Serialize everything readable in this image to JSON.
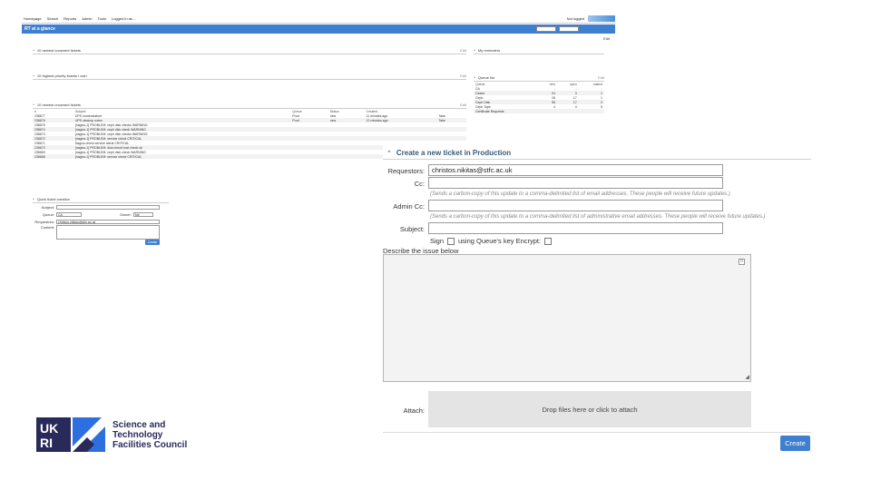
{
  "background": {
    "nav": [
      "Homepage",
      "Search",
      "Reports",
      "Admin",
      "Tools",
      "Logged in as ..."
    ],
    "nav_right": "Not logged",
    "rt_title": "RT at a glance",
    "edit": "Edit",
    "panels": {
      "most_recent": "10 newest unowned tickets",
      "highest_priority": "10 highest priority tickets I own",
      "unowned": "10 newest unowned tickets",
      "my_reminders": "My reminders",
      "quick_ticket": "Quick ticket creation",
      "queue_list": "Queue list",
      "edit_label": "Edit"
    },
    "unowned_headers": [
      "#",
      "Subject",
      "Queue",
      "Status",
      "Created",
      ""
    ],
    "unowned_rows": [
      [
        "238677",
        "UPS nomenclature",
        "Prod",
        "new",
        "11 minutes ago",
        "Take"
      ],
      [
        "238676",
        "UPS cleanup notes",
        "Prod",
        "new",
        "12 minutes ago",
        "Take"
      ],
      [
        "238675",
        "[nagios-1] PROBLEM: ceph disk checks WARNING",
        "",
        "",
        "",
        ""
      ],
      [
        "238674",
        "[nagios-1] PROBLEM: ceph disk check WARNING",
        "",
        "",
        "",
        ""
      ],
      [
        "238673",
        "[nagios-1] PROBLEM: ceph disk checks WARNING",
        "",
        "",
        "",
        ""
      ],
      [
        "238672",
        "[nagios-1] PROBLEM: service check CRITICAL",
        "",
        "",
        "",
        ""
      ],
      [
        "238671",
        "Nagios check service alerts CRITICAL",
        "",
        "",
        "",
        ""
      ],
      [
        "238670",
        "[nagios-1] PROBLEM: disk check host check ok",
        "",
        "",
        "",
        ""
      ],
      [
        "238669",
        "[nagios-1] PROBLEM: ceph disk check WARNING",
        "",
        "",
        "",
        ""
      ],
      [
        "238668",
        "[nagios-1] PROBLEM: service check CRITICAL",
        "",
        "",
        "",
        ""
      ]
    ],
    "queue_headers": [
      "Queue",
      "new",
      "open",
      "stalled"
    ],
    "queue_rows": [
      [
        "CA",
        "-",
        "-",
        "-"
      ],
      [
        "Castor",
        "31",
        "3",
        "1"
      ],
      [
        "Ceph",
        "26",
        "17",
        "1"
      ],
      [
        "Ceph Disk",
        "55",
        "17",
        "2"
      ],
      [
        "Ceph Tape",
        "4",
        "4",
        "5"
      ],
      [
        "Certificate Requests",
        "",
        "",
        ""
      ]
    ],
    "quick_form": {
      "subject_label": "Subject:",
      "queue_label": "Queue:",
      "queue_value": "CA",
      "owner_label": "Owner:",
      "owner_value": "Me",
      "requestors_label": "Requestors:",
      "requestors_value": "christos.nikitas@stfc.ac.uk",
      "content_label": "Content:",
      "create_label": "Create"
    }
  },
  "form": {
    "title": "Create a new ticket in Production",
    "requestors_label": "Requestors:",
    "requestors_value": "christos.nikitas@stfc.ac.uk",
    "cc_label": "Cc:",
    "cc_hint": "(Sends a carbon-copy of this update to a comma-delimited list of email addresses. These people will receive future updates.)",
    "admin_cc_label": "Admin Cc:",
    "admin_cc_hint": "(Sends a carbon-copy of this update to a comma-delimited list of administrative email addresses. These people will receive future updates.)",
    "subject_label": "Subject:",
    "sign_label": "Sign",
    "encrypt_label": "using Queue's key Encrypt:",
    "describe_label": "Describe the issue below",
    "attach_label": "Attach:",
    "dropzone_text": "Drop files here or click to attach",
    "create_label": "Create"
  },
  "logo": {
    "mark": "UKRI",
    "line1": "Science and",
    "line2": "Technology",
    "line3": "Facilities Council"
  },
  "colors": {
    "accent": "#3f7fd0",
    "title": "#3a5a78",
    "logo_navy": "#2a2a5a",
    "logo_blue": "#2e6fe0"
  }
}
